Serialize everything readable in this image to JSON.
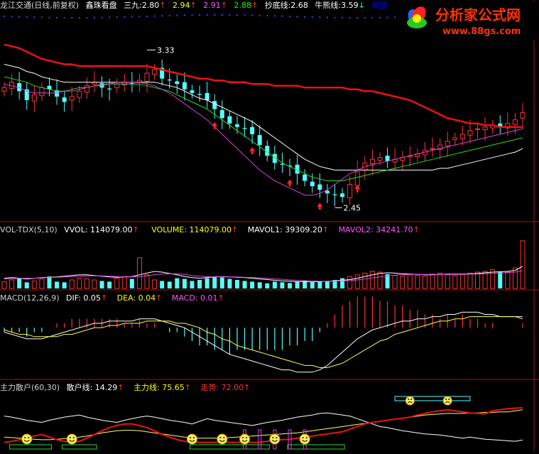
{
  "header": {
    "name": "龙江交通(日线,前复权)",
    "p1_label": "鑫珠看盘",
    "p2_label": "三九:",
    "p2_value": "2.80",
    "v3": "2.94",
    "v4": "2.91",
    "v5": "2.88",
    "p6_label": "抄底线:",
    "p6_value": "2.68",
    "p7_label": "牛熊线:",
    "p7_value": "3.59",
    "p8": "观望"
  },
  "watermark": {
    "title": "分析家公式网",
    "url": "www.88gs.com"
  },
  "price_panel": {
    "high_label": "3.33",
    "low_label": "2.45"
  },
  "vol_panel": {
    "name": "VOL-TDX(5,10)",
    "vvol": "VVOL: 114079.00",
    "volume": "VOLUME: 114079.00",
    "mavol1": "MAVOL1: 39309.20",
    "mavol2": "MAVOL2: 34241.70"
  },
  "macd_panel": {
    "name": "MACD(12,26,9)",
    "dif": "DIF: 0.05",
    "dea": "DEA: 0.04",
    "macd": "MACD: 0.01"
  },
  "sanhu_panel": {
    "name": "主力散户(60,30)",
    "sanhu": "散户线: 14.29",
    "zhuli": "主力线: 75.65",
    "zoushi": "走势: 72.00"
  },
  "chart_data": {
    "type": "candlestick",
    "bars": 70,
    "annotations": [
      "3.33",
      "2.45"
    ],
    "price": {
      "close": [
        3.12,
        3.15,
        3.1,
        3.05,
        3.08,
        3.12,
        3.11,
        3.07,
        3.04,
        3.07,
        3.1,
        3.13,
        3.15,
        3.12,
        3.11,
        3.14,
        3.15,
        3.14,
        3.16,
        3.2,
        3.22,
        3.17,
        3.16,
        3.14,
        3.11,
        3.09,
        3.08,
        3.05,
        3.0,
        2.95,
        2.92,
        2.9,
        2.89,
        2.86,
        2.8,
        2.74,
        2.7,
        2.69,
        2.68,
        2.64,
        2.6,
        2.57,
        2.55,
        2.53,
        2.52,
        2.51,
        2.58,
        2.65,
        2.7,
        2.72,
        2.73,
        2.71,
        2.72,
        2.73,
        2.74,
        2.75,
        2.77,
        2.78,
        2.8,
        2.82,
        2.84,
        2.86,
        2.88,
        2.89,
        2.9,
        2.91,
        2.9,
        2.92,
        2.94,
        2.98
      ],
      "ma_red": [
        3.36,
        3.35,
        3.34,
        3.32,
        3.3,
        3.28,
        3.27,
        3.26,
        3.25,
        3.25,
        3.24,
        3.24,
        3.24,
        3.24,
        3.24,
        3.24,
        3.24,
        3.24,
        3.24,
        3.24,
        3.23,
        3.22,
        3.21,
        3.2,
        3.19,
        3.18,
        3.17,
        3.17,
        3.16,
        3.16,
        3.15,
        3.15,
        3.15,
        3.14,
        3.14,
        3.14,
        3.13,
        3.13,
        3.13,
        3.13,
        3.12,
        3.12,
        3.12,
        3.12,
        3.12,
        3.12,
        3.11,
        3.11,
        3.1,
        3.1,
        3.09,
        3.08,
        3.07,
        3.06,
        3.05,
        3.03,
        3.01,
        2.99,
        2.97,
        2.95,
        2.94,
        2.93,
        2.92,
        2.92,
        2.91,
        2.91,
        2.9,
        2.9,
        2.9,
        2.9
      ],
      "ma_white": [
        3.25,
        3.24,
        3.23,
        3.21,
        3.2,
        3.18,
        3.17,
        3.16,
        3.15,
        3.15,
        3.15,
        3.15,
        3.15,
        3.15,
        3.15,
        3.15,
        3.15,
        3.15,
        3.15,
        3.15,
        3.15,
        3.14,
        3.13,
        3.12,
        3.1,
        3.08,
        3.06,
        3.05,
        3.03,
        3.01,
        2.99,
        2.97,
        2.95,
        2.93,
        2.9,
        2.87,
        2.84,
        2.81,
        2.78,
        2.75,
        2.72,
        2.7,
        2.68,
        2.67,
        2.66,
        2.66,
        2.66,
        2.66,
        2.66,
        2.66,
        2.66,
        2.66,
        2.66,
        2.66,
        2.66,
        2.66,
        2.66,
        2.66,
        2.67,
        2.67,
        2.68,
        2.69,
        2.7,
        2.71,
        2.72,
        2.73,
        2.74,
        2.75,
        2.76,
        2.78
      ],
      "ma_green": [
        3.18,
        3.17,
        3.16,
        3.15,
        3.13,
        3.12,
        3.11,
        3.1,
        3.1,
        3.11,
        3.12,
        3.12,
        3.13,
        3.13,
        3.14,
        3.14,
        3.14,
        3.14,
        3.14,
        3.13,
        3.12,
        3.11,
        3.1,
        3.08,
        3.06,
        3.04,
        3.02,
        3.0,
        2.97,
        2.94,
        2.91,
        2.88,
        2.85,
        2.82,
        2.79,
        2.76,
        2.73,
        2.7,
        2.68,
        2.66,
        2.64,
        2.62,
        2.61,
        2.6,
        2.6,
        2.6,
        2.61,
        2.62,
        2.63,
        2.64,
        2.65,
        2.66,
        2.67,
        2.68,
        2.69,
        2.7,
        2.71,
        2.72,
        2.73,
        2.74,
        2.75,
        2.76,
        2.77,
        2.78,
        2.79,
        2.8,
        2.81,
        2.82,
        2.83,
        2.84
      ],
      "ma_magenta": [
        3.14,
        3.13,
        3.12,
        3.1,
        3.09,
        3.09,
        3.09,
        3.09,
        3.1,
        3.1,
        3.11,
        3.12,
        3.13,
        3.14,
        3.14,
        3.15,
        3.15,
        3.15,
        3.15,
        3.14,
        3.13,
        3.11,
        3.09,
        3.06,
        3.03,
        3.0,
        2.97,
        2.94,
        2.9,
        2.86,
        2.82,
        2.78,
        2.74,
        2.7,
        2.66,
        2.63,
        2.6,
        2.58,
        2.56,
        2.54,
        2.52,
        2.52,
        2.53,
        2.55,
        2.58,
        2.61,
        2.64,
        2.66,
        2.68,
        2.69,
        2.7,
        2.71,
        2.72,
        2.73,
        2.74,
        2.75,
        2.76,
        2.77,
        2.78,
        2.79,
        2.8,
        2.81,
        2.82,
        2.83,
        2.84,
        2.85,
        2.86,
        2.87,
        2.88,
        2.89
      ],
      "ylim": [
        2.4,
        3.45
      ]
    },
    "volume": {
      "values": [
        20,
        25,
        30,
        18,
        22,
        28,
        35,
        20,
        18,
        25,
        30,
        28,
        25,
        22,
        20,
        30,
        35,
        28,
        90,
        40,
        25,
        22,
        20,
        30,
        28,
        22,
        25,
        30,
        35,
        32,
        28,
        25,
        22,
        20,
        18,
        15,
        20,
        18,
        16,
        20,
        22,
        18,
        20,
        22,
        25,
        30,
        35,
        40,
        45,
        50,
        48,
        42,
        38,
        35,
        40,
        38,
        36,
        42,
        45,
        40,
        38,
        42,
        45,
        48,
        50,
        55,
        50,
        48,
        60,
        140
      ],
      "ma1": [
        30,
        32,
        30,
        28,
        30,
        32,
        33,
        34,
        36,
        38,
        40,
        40,
        38,
        36,
        34,
        33,
        34,
        35,
        40,
        45,
        50,
        48,
        44,
        40,
        35,
        32,
        30,
        32,
        34,
        35,
        34,
        33,
        32,
        30,
        28,
        26,
        24,
        22,
        21,
        20,
        20,
        19,
        20,
        21,
        22,
        24,
        26,
        30,
        35,
        40,
        44,
        46,
        45,
        43,
        42,
        41,
        40,
        40,
        41,
        42,
        42,
        42,
        43,
        44,
        46,
        48,
        49,
        50,
        53,
        65
      ],
      "ma2": [
        28,
        29,
        30,
        30,
        30,
        31,
        32,
        33,
        34,
        35,
        36,
        37,
        37,
        37,
        36,
        35,
        34,
        34,
        35,
        37,
        40,
        42,
        43,
        43,
        41,
        38,
        36,
        35,
        34,
        34,
        34,
        34,
        33,
        32,
        31,
        30,
        28,
        27,
        25,
        24,
        23,
        22,
        21,
        21,
        21,
        22,
        23,
        25,
        28,
        31,
        34,
        37,
        39,
        40,
        41,
        41,
        41,
        41,
        41,
        41,
        41,
        41,
        42,
        42,
        43,
        44,
        45,
        46,
        48,
        52
      ],
      "ylim": [
        0,
        150
      ]
    },
    "macd": {
      "dif": [
        -0.02,
        -0.03,
        -0.04,
        -0.05,
        -0.05,
        -0.05,
        -0.04,
        -0.03,
        -0.02,
        -0.01,
        0.0,
        0.01,
        0.02,
        0.02,
        0.03,
        0.03,
        0.03,
        0.03,
        0.04,
        0.04,
        0.04,
        0.03,
        0.02,
        0.01,
        0.0,
        -0.02,
        -0.04,
        -0.06,
        -0.08,
        -0.1,
        -0.12,
        -0.13,
        -0.14,
        -0.15,
        -0.16,
        -0.17,
        -0.18,
        -0.19,
        -0.19,
        -0.2,
        -0.2,
        -0.2,
        -0.19,
        -0.17,
        -0.14,
        -0.11,
        -0.08,
        -0.05,
        -0.03,
        -0.01,
        0.0,
        0.01,
        0.02,
        0.03,
        0.03,
        0.04,
        0.04,
        0.05,
        0.05,
        0.06,
        0.06,
        0.07,
        0.07,
        0.07,
        0.06,
        0.06,
        0.05,
        0.05,
        0.05,
        0.05
      ],
      "dea": [
        -0.01,
        -0.02,
        -0.03,
        -0.03,
        -0.04,
        -0.04,
        -0.04,
        -0.04,
        -0.03,
        -0.03,
        -0.02,
        -0.01,
        0.0,
        0.0,
        0.01,
        0.01,
        0.02,
        0.02,
        0.02,
        0.03,
        0.03,
        0.03,
        0.03,
        0.02,
        0.02,
        0.01,
        0.0,
        -0.02,
        -0.03,
        -0.05,
        -0.06,
        -0.08,
        -0.09,
        -0.1,
        -0.11,
        -0.12,
        -0.13,
        -0.14,
        -0.15,
        -0.16,
        -0.17,
        -0.17,
        -0.18,
        -0.18,
        -0.17,
        -0.16,
        -0.14,
        -0.12,
        -0.1,
        -0.08,
        -0.06,
        -0.05,
        -0.03,
        -0.02,
        -0.01,
        0.0,
        0.01,
        0.02,
        0.03,
        0.03,
        0.04,
        0.04,
        0.05,
        0.05,
        0.05,
        0.05,
        0.05,
        0.05,
        0.05,
        0.04
      ],
      "hist": [
        -0.02,
        -0.02,
        -0.02,
        -0.04,
        -0.02,
        -0.02,
        0.0,
        0.02,
        0.02,
        0.04,
        0.04,
        0.04,
        0.04,
        0.04,
        0.04,
        0.04,
        0.02,
        0.02,
        0.04,
        0.02,
        0.02,
        0.0,
        -0.02,
        -0.02,
        -0.04,
        -0.06,
        -0.08,
        -0.08,
        -0.1,
        -0.1,
        -0.12,
        -0.1,
        -0.1,
        -0.1,
        -0.1,
        -0.1,
        -0.1,
        -0.1,
        -0.08,
        -0.08,
        -0.06,
        -0.06,
        -0.02,
        0.02,
        0.06,
        0.1,
        0.12,
        0.14,
        0.14,
        0.14,
        0.12,
        0.12,
        0.1,
        0.1,
        0.08,
        0.08,
        0.06,
        0.06,
        0.04,
        0.06,
        0.04,
        0.06,
        0.04,
        0.04,
        0.02,
        0.02,
        0.0,
        0.0,
        0.0,
        0.02
      ],
      "ylim": [
        -0.22,
        0.1
      ]
    },
    "sanhu": {
      "sanhu_line": [
        60,
        58,
        55,
        52,
        50,
        48,
        52,
        55,
        58,
        60,
        62,
        58,
        55,
        52,
        50,
        48,
        52,
        55,
        58,
        60,
        58,
        55,
        52,
        50,
        48,
        45,
        50,
        55,
        52,
        50,
        48,
        46,
        44,
        42,
        45,
        48,
        50,
        52,
        55,
        58,
        60,
        62,
        65,
        66,
        64,
        62,
        60,
        55,
        50,
        45,
        40,
        38,
        35,
        32,
        30,
        28,
        26,
        25,
        24,
        22,
        20,
        18,
        20,
        18,
        16,
        15,
        14,
        13,
        12,
        14.29
      ],
      "zhuli_line": [
        10,
        12,
        15,
        18,
        22,
        25,
        20,
        15,
        12,
        10,
        12,
        18,
        25,
        32,
        38,
        42,
        45,
        45,
        42,
        38,
        32,
        25,
        20,
        15,
        12,
        10,
        10,
        10,
        10,
        10,
        10,
        10,
        10,
        10,
        10,
        12,
        14,
        15,
        16,
        18,
        20,
        22,
        24,
        26,
        28,
        30,
        35,
        40,
        45,
        48,
        50,
        52,
        54,
        56,
        58,
        62,
        65,
        68,
        70,
        72,
        70,
        68,
        66,
        65,
        64,
        70,
        72,
        74,
        75,
        75.65
      ],
      "yellow_line": [
        20,
        19,
        18,
        17,
        16,
        15,
        15,
        16,
        17,
        18,
        20,
        22,
        25,
        28,
        30,
        32,
        33,
        33,
        32,
        30,
        28,
        26,
        24,
        22,
        20,
        19,
        18,
        18,
        18,
        18,
        19,
        20,
        21,
        22,
        23,
        24,
        25,
        26,
        27,
        28,
        30,
        32,
        34,
        36,
        38,
        40,
        42,
        44,
        46,
        48,
        50,
        52,
        54,
        56,
        58,
        60,
        62,
        63,
        64,
        65,
        65,
        65,
        66,
        66,
        67,
        67,
        68,
        68,
        70,
        72
      ]
    }
  }
}
